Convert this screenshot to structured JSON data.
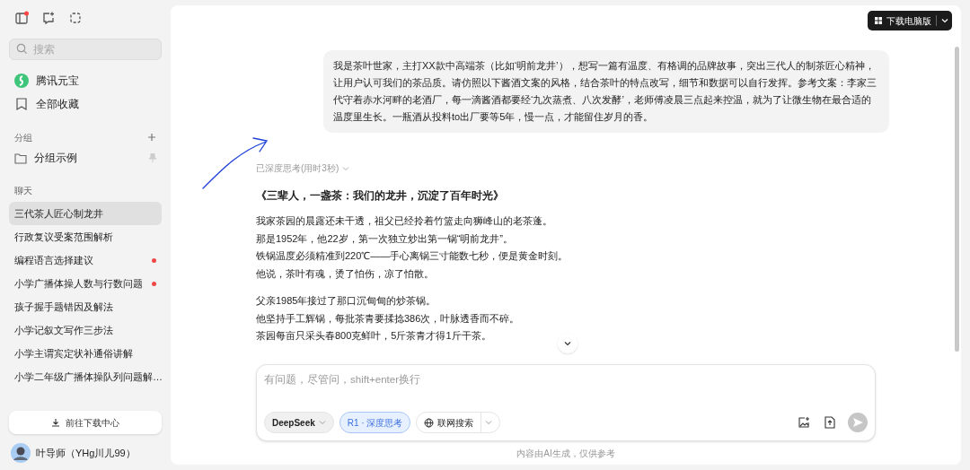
{
  "sidebar": {
    "search": {
      "placeholder": "搜索"
    },
    "nav": [
      {
        "kind": "app",
        "label": "腾讯元宝"
      },
      {
        "kind": "favorites",
        "label": "全部收藏"
      }
    ],
    "groups": {
      "title": "分组",
      "items": [
        {
          "label": "分组示例"
        }
      ]
    },
    "chats": {
      "title": "聊天",
      "items": [
        {
          "label": "三代茶人匠心制龙井",
          "selected": true,
          "unread": false
        },
        {
          "label": "行政复议受案范围解析",
          "selected": false,
          "unread": false
        },
        {
          "label": "编程语言选择建议",
          "selected": false,
          "unread": true
        },
        {
          "label": "小学广播体操人数与行数问题",
          "selected": false,
          "unread": true
        },
        {
          "label": "孩子握手题错因及解法",
          "selected": false,
          "unread": false
        },
        {
          "label": "小学记叙文写作三步法",
          "selected": false,
          "unread": false
        },
        {
          "label": "小学主谓宾定状补通俗讲解",
          "selected": false,
          "unread": false
        },
        {
          "label": "小学二年级广播体操队列问题解…",
          "selected": false,
          "unread": false
        }
      ]
    },
    "download_button": "前往下载中心",
    "user": {
      "name": "叶导师（YHg川儿99）"
    }
  },
  "header": {
    "download_button": "下载电脑版"
  },
  "user_message": {
    "text": "我是茶叶世家，主打XX款中高端茶（比如‘明前龙井’），想写一篇有温度、有格调的品牌故事，突出三代人的制茶匠心精神，让用户认可我们的茶品质。请仿照以下酱酒文案的风格，结合茶叶的特点改写，细节和数据可以自行发挥。参考文案：李家三代守着赤水河畔的老酒厂，每一滴酱酒都要经‘九次蒸煮、八次发酵’，老师傅凌晨三点起来控温，就为了让微生物在最合适的温度里生长。一瓶酒从投料to出厂要等5年，慢一点，才能留住岁月的香。"
  },
  "response": {
    "thinking": "已深度思考(用时3秒)",
    "title": "《三辈人，一盏茶：我们的龙井，沉淀了百年时光》",
    "paragraphs": [
      [
        "我家茶园的晨露还未干透，祖父已经拎着竹篮走向狮峰山的老茶蓬。",
        "那是1952年，他22岁，第一次独立炒出第一锅“明前龙井”。",
        "铁锅温度必须精准到220℃——手心离锅三寸能数七秒，便是黄金时刻。",
        "他说，茶叶有魂，烫了怕伤，凉了怕散。"
      ],
      [
        "父亲1985年接过了那口沉甸甸的炒茶锅。",
        "他坚持手工辉锅，每批茶青要揉捻386次，叶脉透香而不碎。",
        "茶园每亩只采头春800克鲜叶，5斤茶青才得1斤干茶。"
      ]
    ]
  },
  "composer": {
    "placeholder": "有问题，尽管问，shift+enter换行",
    "chips": [
      {
        "kind": "model",
        "label": "DeepSeek",
        "selected": false
      },
      {
        "kind": "mode",
        "label": "R1 · 深度思考",
        "selected": true
      },
      {
        "kind": "search",
        "label": "联网搜索",
        "selected": false
      }
    ]
  },
  "footer_note": "内容由AI生成，仅供参考"
}
